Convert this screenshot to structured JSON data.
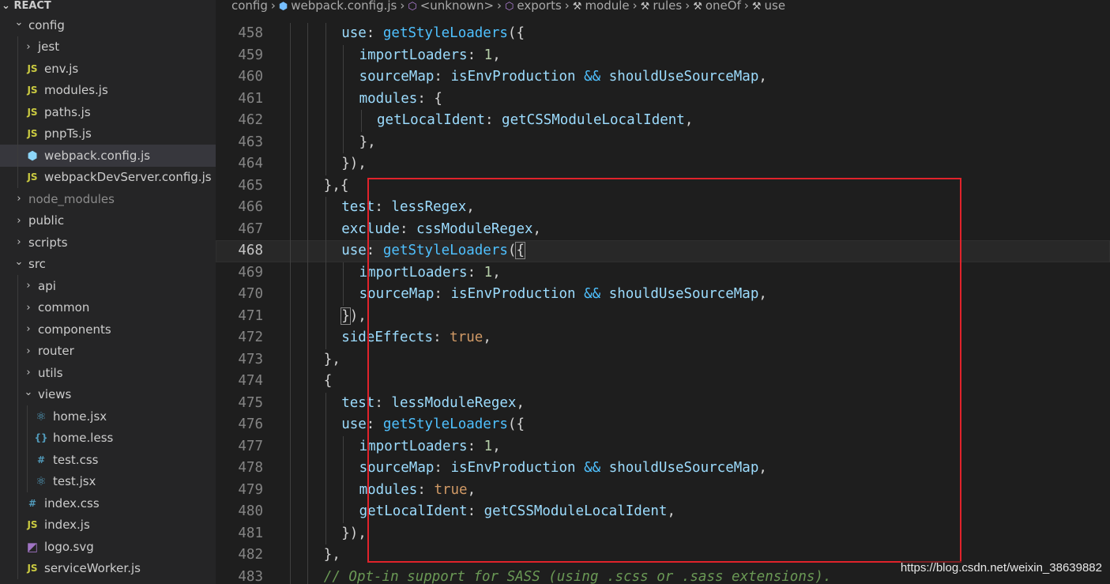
{
  "sidebar": {
    "header": "REACT",
    "items": [
      {
        "label": "config",
        "kind": "folder-open",
        "depth": 0
      },
      {
        "label": "jest",
        "kind": "folder",
        "depth": 1
      },
      {
        "label": "env.js",
        "kind": "js",
        "depth": 1
      },
      {
        "label": "modules.js",
        "kind": "js",
        "depth": 1
      },
      {
        "label": "paths.js",
        "kind": "js",
        "depth": 1
      },
      {
        "label": "pnpTs.js",
        "kind": "js",
        "depth": 1
      },
      {
        "label": "webpack.config.js",
        "kind": "webpack",
        "depth": 1,
        "active": true
      },
      {
        "label": "webpackDevServer.config.js",
        "kind": "js",
        "depth": 1
      },
      {
        "label": "node_modules",
        "kind": "folder",
        "depth": 0,
        "dim": true
      },
      {
        "label": "public",
        "kind": "folder",
        "depth": 0
      },
      {
        "label": "scripts",
        "kind": "folder",
        "depth": 0
      },
      {
        "label": "src",
        "kind": "folder-open",
        "depth": 0
      },
      {
        "label": "api",
        "kind": "folder",
        "depth": 1
      },
      {
        "label": "common",
        "kind": "folder",
        "depth": 1
      },
      {
        "label": "components",
        "kind": "folder",
        "depth": 1
      },
      {
        "label": "router",
        "kind": "folder",
        "depth": 1
      },
      {
        "label": "utils",
        "kind": "folder",
        "depth": 1
      },
      {
        "label": "views",
        "kind": "folder-open",
        "depth": 1
      },
      {
        "label": "home.jsx",
        "kind": "react",
        "depth": 2
      },
      {
        "label": "home.less",
        "kind": "less",
        "depth": 2
      },
      {
        "label": "test.css",
        "kind": "css",
        "depth": 2
      },
      {
        "label": "test.jsx",
        "kind": "react",
        "depth": 2
      },
      {
        "label": "index.css",
        "kind": "css",
        "depth": 1
      },
      {
        "label": "index.js",
        "kind": "js",
        "depth": 1
      },
      {
        "label": "logo.svg",
        "kind": "svg",
        "depth": 1
      },
      {
        "label": "serviceWorker.js",
        "kind": "js",
        "depth": 1
      }
    ],
    "icon_glyphs": {
      "js": "JS",
      "css": "#",
      "less": "{}",
      "react": "⚛",
      "webpack": "⬢",
      "svg": "◩"
    },
    "icon_colors": {
      "js": "#cbcb41",
      "css": "#519aba",
      "less": "#519aba",
      "react": "#519aba",
      "webpack": "#8dd6f9",
      "svg": "#a074c4"
    }
  },
  "breadcrumb": [
    {
      "label": "config",
      "icon": ""
    },
    {
      "label": "webpack.config.js",
      "icon": "webpack-icon"
    },
    {
      "label": "<unknown>",
      "icon": "cube-icon"
    },
    {
      "label": "exports",
      "icon": "cube-icon"
    },
    {
      "label": "module",
      "icon": "wrench-icon"
    },
    {
      "label": "rules",
      "icon": "wrench-icon"
    },
    {
      "label": "oneOf",
      "icon": "wrench-icon"
    },
    {
      "label": "use",
      "icon": "wrench-icon"
    }
  ],
  "editor": {
    "current_line": 468,
    "lines": [
      {
        "n": "458",
        "indent": 3,
        "tokens": [
          [
            "use",
            "prop"
          ],
          [
            ": ",
            "punc"
          ],
          [
            "getStyleLoaders",
            "fn"
          ],
          [
            "({",
            "punc"
          ]
        ]
      },
      {
        "n": "459",
        "indent": 4,
        "tokens": [
          [
            "importLoaders",
            "prop"
          ],
          [
            ": ",
            "punc"
          ],
          [
            "1",
            "num"
          ],
          [
            ",",
            "punc"
          ]
        ]
      },
      {
        "n": "460",
        "indent": 4,
        "tokens": [
          [
            "sourceMap",
            "prop"
          ],
          [
            ": ",
            "punc"
          ],
          [
            "isEnvProduction",
            "ident"
          ],
          [
            " && ",
            "op"
          ],
          [
            "shouldUseSourceMap",
            "ident"
          ],
          [
            ",",
            "punc"
          ]
        ]
      },
      {
        "n": "461",
        "indent": 4,
        "tokens": [
          [
            "modules",
            "prop"
          ],
          [
            ": {",
            "punc"
          ]
        ]
      },
      {
        "n": "462",
        "indent": 5,
        "tokens": [
          [
            "getLocalIdent",
            "prop"
          ],
          [
            ": ",
            "punc"
          ],
          [
            "getCSSModuleLocalIdent",
            "ident"
          ],
          [
            ",",
            "punc"
          ]
        ]
      },
      {
        "n": "463",
        "indent": 4,
        "tokens": [
          [
            "},",
            "punc"
          ]
        ]
      },
      {
        "n": "464",
        "indent": 3,
        "tokens": [
          [
            "}),",
            "punc"
          ]
        ]
      },
      {
        "n": "465",
        "indent": 2,
        "tokens": [
          [
            "},{",
            "punc"
          ]
        ]
      },
      {
        "n": "466",
        "indent": 3,
        "tokens": [
          [
            "test",
            "prop"
          ],
          [
            ": ",
            "punc"
          ],
          [
            "lessRegex",
            "ident"
          ],
          [
            ",",
            "punc"
          ]
        ]
      },
      {
        "n": "467",
        "indent": 3,
        "tokens": [
          [
            "exclude",
            "prop"
          ],
          [
            ": ",
            "punc"
          ],
          [
            "cssModuleRegex",
            "ident"
          ],
          [
            ",",
            "punc"
          ]
        ]
      },
      {
        "n": "468",
        "indent": 3,
        "tokens": [
          [
            "use",
            "prop"
          ],
          [
            ": ",
            "punc"
          ],
          [
            "getStyleLoaders",
            "fn"
          ],
          [
            "(",
            "punc"
          ],
          [
            "{",
            "match"
          ]
        ]
      },
      {
        "n": "469",
        "indent": 4,
        "tokens": [
          [
            "importLoaders",
            "prop"
          ],
          [
            ": ",
            "punc"
          ],
          [
            "1",
            "num"
          ],
          [
            ",",
            "punc"
          ]
        ]
      },
      {
        "n": "470",
        "indent": 4,
        "tokens": [
          [
            "sourceMap",
            "prop"
          ],
          [
            ": ",
            "punc"
          ],
          [
            "isEnvProduction",
            "ident"
          ],
          [
            " && ",
            "op"
          ],
          [
            "shouldUseSourceMap",
            "ident"
          ],
          [
            ",",
            "punc"
          ]
        ]
      },
      {
        "n": "471",
        "indent": 3,
        "tokens": [
          [
            "}",
            "match"
          ],
          [
            "),",
            "punc"
          ]
        ]
      },
      {
        "n": "472",
        "indent": 3,
        "tokens": [
          [
            "sideEffects",
            "prop"
          ],
          [
            ": ",
            "punc"
          ],
          [
            "true",
            "bool"
          ],
          [
            ",",
            "punc"
          ]
        ]
      },
      {
        "n": "473",
        "indent": 2,
        "tokens": [
          [
            "},",
            "punc"
          ]
        ]
      },
      {
        "n": "474",
        "indent": 2,
        "tokens": [
          [
            "{",
            "punc"
          ]
        ]
      },
      {
        "n": "475",
        "indent": 3,
        "tokens": [
          [
            "test",
            "prop"
          ],
          [
            ": ",
            "punc"
          ],
          [
            "lessModuleRegex",
            "ident"
          ],
          [
            ",",
            "punc"
          ]
        ]
      },
      {
        "n": "476",
        "indent": 3,
        "tokens": [
          [
            "use",
            "prop"
          ],
          [
            ": ",
            "punc"
          ],
          [
            "getStyleLoaders",
            "fn"
          ],
          [
            "({",
            "punc"
          ]
        ]
      },
      {
        "n": "477",
        "indent": 4,
        "tokens": [
          [
            "importLoaders",
            "prop"
          ],
          [
            ": ",
            "punc"
          ],
          [
            "1",
            "num"
          ],
          [
            ",",
            "punc"
          ]
        ]
      },
      {
        "n": "478",
        "indent": 4,
        "tokens": [
          [
            "sourceMap",
            "prop"
          ],
          [
            ": ",
            "punc"
          ],
          [
            "isEnvProduction",
            "ident"
          ],
          [
            " && ",
            "op"
          ],
          [
            "shouldUseSourceMap",
            "ident"
          ],
          [
            ",",
            "punc"
          ]
        ]
      },
      {
        "n": "479",
        "indent": 4,
        "tokens": [
          [
            "modules",
            "prop"
          ],
          [
            ": ",
            "punc"
          ],
          [
            "true",
            "bool"
          ],
          [
            ",",
            "punc"
          ]
        ]
      },
      {
        "n": "480",
        "indent": 4,
        "tokens": [
          [
            "getLocalIdent",
            "prop"
          ],
          [
            ": ",
            "punc"
          ],
          [
            "getCSSModuleLocalIdent",
            "ident"
          ],
          [
            ",",
            "punc"
          ]
        ]
      },
      {
        "n": "481",
        "indent": 3,
        "tokens": [
          [
            "}),",
            "punc"
          ]
        ]
      },
      {
        "n": "482",
        "indent": 2,
        "tokens": [
          [
            "},",
            "punc"
          ]
        ]
      },
      {
        "n": "483",
        "indent": 2,
        "tokens": [
          [
            "// Opt-in support for SASS (using .scss or .sass extensions).",
            "comment"
          ]
        ]
      }
    ]
  },
  "annotation": {
    "color": "#e0232b"
  },
  "watermark": "https://blog.csdn.net/weixin_38639882",
  "colors": {
    "prop": "#9cdcfe",
    "fn": "#4fc1ff",
    "num": "#b5cea8",
    "bool": "#d19a66",
    "ident": "#9cdcfe",
    "punc": "#d4d4d4",
    "op": "#4fc1ff",
    "comment": "#6a9955"
  }
}
